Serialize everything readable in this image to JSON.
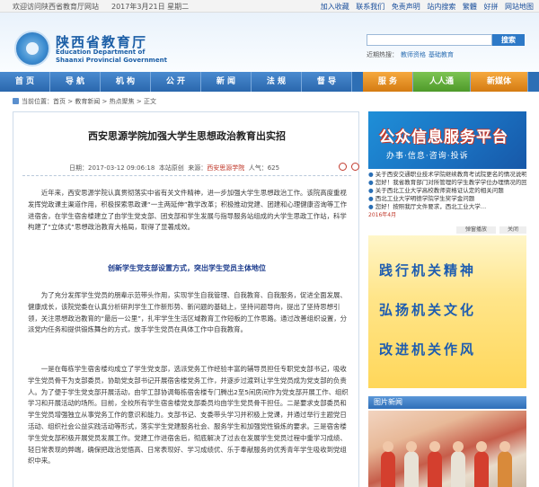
{
  "topbar": {
    "welcome": "欢迎访问陕西省教育厅网站",
    "date": "2017年3月21日 星期二",
    "links": [
      "加入收藏",
      "联系我们",
      "免责声明",
      "站内搜索",
      "繁體",
      "好拼",
      "网站地图"
    ]
  },
  "header": {
    "site_name_cn": "陕西省教育厅",
    "site_name_en_line1": "Education Department of",
    "site_name_en_line2": "Shaanxi Provincial Government",
    "search_button": "搜索",
    "hot_label": "近期热搜：",
    "hot_items": [
      "教师资格",
      "基础教育"
    ]
  },
  "nav": {
    "items": [
      {
        "label": "首 页",
        "style": "blue"
      },
      {
        "label": "导 航",
        "style": "blue"
      },
      {
        "label": "机 构",
        "style": "blue"
      },
      {
        "label": "公 开",
        "style": "blue"
      },
      {
        "label": "新 闻",
        "style": "blue"
      },
      {
        "label": "法 规",
        "style": "blue"
      },
      {
        "label": "督 导",
        "style": "blue"
      },
      {
        "label": "服 务",
        "style": "orange"
      },
      {
        "label": "人人通",
        "style": "green"
      },
      {
        "label": "新媒体",
        "style": "orange"
      }
    ]
  },
  "breadcrumb": "当前位置：首页 > 教育新闻 > 热点聚焦 > 正文",
  "article": {
    "title": "西安思源学院加强大学生思想政治教育出实招",
    "meta_date": "日期：2017-03-12 09:06:18",
    "meta_source": "本站原创",
    "meta_author_label": "来源：",
    "meta_author": "西安思源学院",
    "meta_views": "人气：625",
    "para1": "近年来，西安思源学院认真贯彻落实中省有关文件精神，进一步加强大学生思想政治工作。该院高度重视发挥党政课主渠道作用，积极探索思政课“一主两延伸”教学改革；积极推动党建、团建和心理健康咨询等工作进宿舍，在学生宿舍楼建立了由学生党支部、团支部和学生发展与指导服务站组成的大学生思政工作站，科学构建了“立体式”思想政治教育大格局，取得了显著成效。",
    "subhead": "创新学生党支部设置方式，突出学生党员主体地位",
    "para2": "为了充分发挥学生党员的朋辈示范带头作用，实现学生自我管理、自我教育、自我服务，促进全面发展、健康成长，该院党委在认真分析研判学生工作新形势、新问题的基础上，坚持问题导向，提出了坚持思想引领，关注思想政治教育的“最后一公里”，扎牢学生生活区域教育工作短板的工作思路。通过改善组织设置，分派党内任务和提供锻炼舞台的方式，放手学生党员在具体工作中自我教育。",
    "para3": "一是在每栋学生宿舍楼均成立了学生党支部，选派党务工作经验丰富的辅导员担任专职党支部书记，吸收学生党员骨干为支部委员，协助党支部书记开展宿舍楼党务工作，并逐步过渡到让学生党员成为党支部的负责人。为了便于学生党支部开展活动，由学工部协调每栋宿舍楼专门腾出2至5间房间作为党支部开展工作、组织学习和开展活动的场所。目前，全校所有学生宿舍楼党支部委员均由学生党员骨干担任。二是要求支部委员和学生党员增强独立从事党务工作的意识和能力。支部书记、支委带头学习并积极上党课，并通过举行主题党日活动、组织社会公益实践活动等形式，落实学生党建服务社会、服务学生和加强党性锻炼的要求。三是宿舍楼学生党支部积极开展党员发展工作。党建工作进宿舍后，彻底解决了过去在发展学生党员过程中重学习成绩、轻日常表现的弊端，确保把政治觉悟高、日常表现好、学习成绩优、乐于奉献服务的优秀青年学生吸收到党组织中来。"
  },
  "sidebar": {
    "banner1_title": "公众信息服务平台",
    "banner1_sub": "办事·信息·咨询·投诉",
    "notices": [
      {
        "text": "关于西安交通职业技术学院继续教育考试院更名的情况说明",
        "date": ""
      },
      {
        "text": "您好！我省教育部门对所管理的学生教学学位办理情况的回复",
        "date": ""
      },
      {
        "text": "关于西北工业大学高校教师资格证认定的相关问题",
        "date": ""
      },
      {
        "text": "西北工业大学明德学院学生奖学金问题",
        "date": ""
      },
      {
        "text": "您好！按照我厅文件要求，西北工业大学…",
        "date": "2016年4月"
      }
    ],
    "ad_label": "弹窗播放",
    "ad_close": "关闭",
    "banner2_lines": [
      "践行机关精神",
      "弘扬机关文化",
      "改进机关作风"
    ],
    "photo_section": "图片新闻"
  },
  "colors": {
    "brand_blue": "#1b5ea6",
    "nav_blue": "#2e6fb5",
    "accent_red": "#c0392b",
    "subhead_blue": "#1a3a8c"
  }
}
